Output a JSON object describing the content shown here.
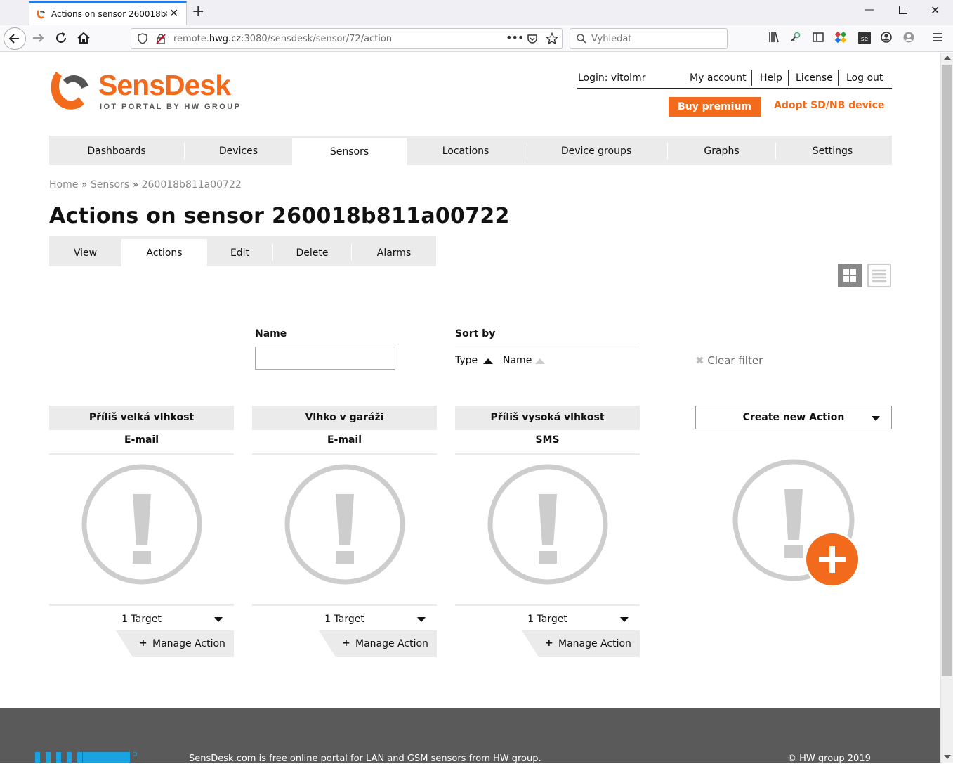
{
  "browser": {
    "tab_title": "Actions on sensor 260018b811a00722",
    "url_host": "remote.hwg.cz",
    "url_path": ":3080/sensdesk/sensor/72/action",
    "url_prefix": "remote.",
    "url_host_main": "hwg.cz",
    "search_placeholder": "Vyhledat"
  },
  "brand": {
    "name": "SensDesk",
    "tagline": "IOT PORTAL BY HW GROUP",
    "accent": "#f26a1b"
  },
  "user": {
    "login": "Login: vitolmr",
    "my_account": "My account",
    "help": "Help",
    "license": "License",
    "logout": "Log out",
    "buy_premium": "Buy premium",
    "adopt": "Adopt SD/NB device"
  },
  "mainnav": [
    "Dashboards",
    "Devices",
    "Sensors",
    "Locations",
    "Device groups",
    "Graphs",
    "Settings"
  ],
  "mainnav_active": "Sensors",
  "breadcrumb": {
    "home": "Home",
    "sensors": "Sensors",
    "current": "260018b811a00722",
    "sep": "»"
  },
  "page_title": "Actions on sensor 260018b811a00722",
  "subnav": [
    "View",
    "Actions",
    "Edit",
    "Delete",
    "Alarms"
  ],
  "subnav_active": "Actions",
  "filter": {
    "name_label": "Name",
    "name_value": "",
    "sort_label": "Sort by",
    "sort_type": "Type",
    "sort_name": "Name",
    "clear": "Clear filter"
  },
  "cards": [
    {
      "title": "Příliš velká vlhkost",
      "type": "E-mail",
      "targets": "1 Target",
      "manage": "Manage Action"
    },
    {
      "title": "Vlhko v garáži",
      "type": "E-mail",
      "targets": "1 Target",
      "manage": "Manage Action"
    },
    {
      "title": "Příliš vysoká vlhkost",
      "type": "SMS",
      "targets": "1 Target",
      "manage": "Manage Action"
    }
  ],
  "create_action": "Create new Action",
  "footer": {
    "text": "SensDesk.com is free online portal for LAN and GSM sensors from HW group.",
    "copyright": "© HW group 2019"
  }
}
